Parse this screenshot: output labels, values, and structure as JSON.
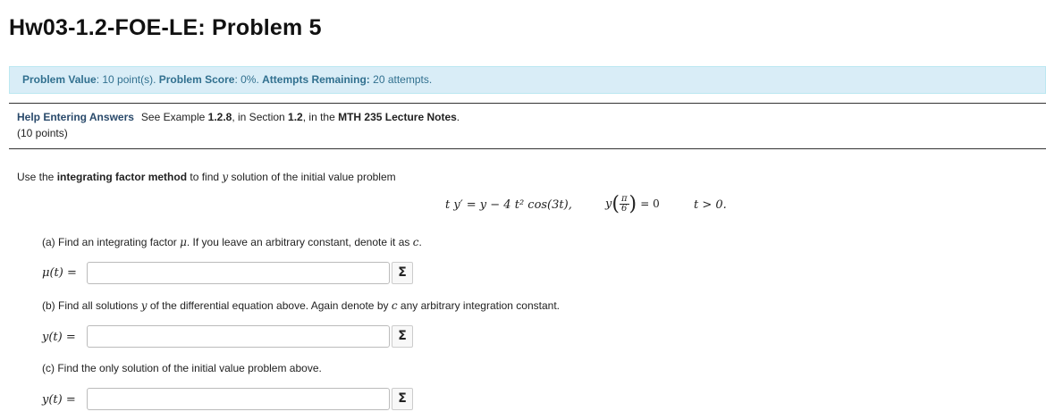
{
  "page": {
    "title": "Hw03-1.2-FOE-LE: Problem 5"
  },
  "info_bar": {
    "value_label": "Problem Value",
    "value_text": ": 10 point(s). ",
    "score_label": "Problem Score",
    "score_text": ": 0%. ",
    "attempts_label": "Attempts Remaining:",
    "attempts_text": " 20 attempts."
  },
  "help": {
    "link_label": "Help Entering Answers",
    "text_prefix": "See Example ",
    "example": "1.2.8",
    "text_mid": ", in Section ",
    "section": "1.2",
    "text_mid2": ", in the ",
    "notes": "MTH 235 Lecture Notes",
    "text_suffix": ".",
    "points": "(10 points)"
  },
  "problem": {
    "intro_prefix": "Use the ",
    "intro_bold": "integrating factor method",
    "intro_mid": " to find ",
    "intro_var": "y",
    "intro_suffix": " solution of the initial value problem",
    "equation": "t y′ = y − 4 t² cos(3t),",
    "ic_left": "y",
    "ic_num": "π",
    "ic_den": "6",
    "ic_right": "= 0",
    "domain": "t > 0."
  },
  "parts": [
    {
      "prompt_prefix": "(a) Find an integrating factor ",
      "prompt_var": "μ",
      "prompt_suffix": ". If you leave an arbitrary constant, denote it as ",
      "prompt_var2": "c",
      "prompt_end": ".",
      "answer_label": "μ(t) =",
      "answer_value": "",
      "sigma": "Σ"
    },
    {
      "prompt_prefix": "(b) Find all solutions ",
      "prompt_var": "y",
      "prompt_suffix": " of the differential equation above. Again denote by ",
      "prompt_var2": "c",
      "prompt_end": " any arbitrary integration constant.",
      "answer_label": "y(t) =",
      "answer_value": "",
      "sigma": "Σ"
    },
    {
      "prompt_prefix": "(c) Find the only solution of the initial value problem above.",
      "answer_label": "y(t) =",
      "answer_value": "",
      "sigma": "Σ"
    }
  ]
}
